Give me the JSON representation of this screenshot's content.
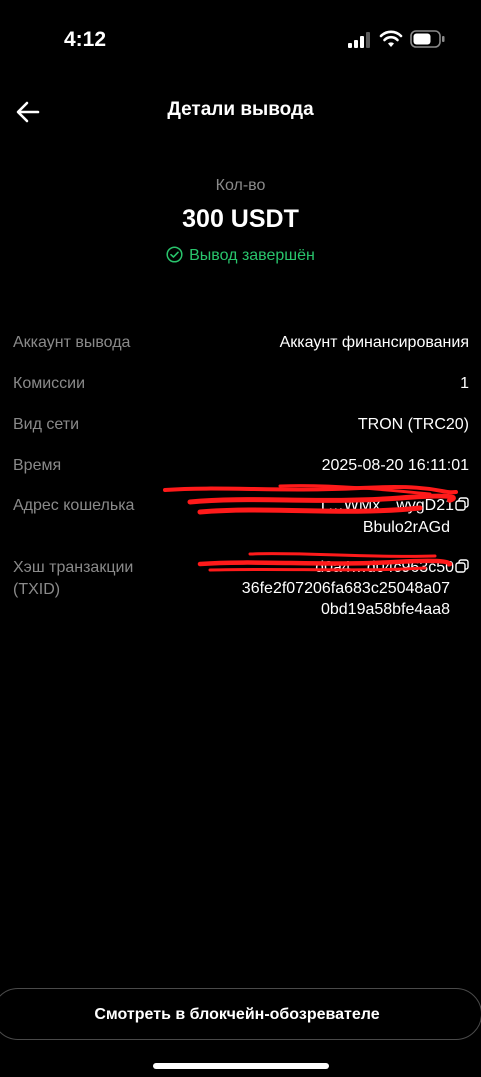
{
  "status_bar": {
    "time": "4:12",
    "signal_icon": "cellular-signal-icon",
    "wifi_icon": "wifi-icon",
    "battery_icon": "battery-icon"
  },
  "header": {
    "back_icon": "arrow-left-icon",
    "title": "Детали вывода"
  },
  "summary": {
    "amount_label": "Кол-во",
    "amount": "300 USDT",
    "status_text": "Вывод завершён",
    "status_icon": "check-circle-icon",
    "status_color": "#29c46c"
  },
  "details": {
    "account": {
      "label": "Аккаунт вывода",
      "value": "Аккаунт финансирования"
    },
    "fee": {
      "label": "Комиссии",
      "value": "1"
    },
    "network": {
      "label": "Вид сети",
      "value": "TRON (TRC20)"
    },
    "time": {
      "label": "Время",
      "value": "2025-08-20 16:11:01"
    },
    "address": {
      "label": "Адрес кошелька",
      "line1": "T…WMx…wygD21",
      "line2": "Bbulo2rAGd",
      "copy_icon": "copy-icon"
    },
    "txid": {
      "label_line1": "Хэш транзакции",
      "label_line2": "(TXID)",
      "line1": "d0a4…d04c963c50",
      "line2": "36fe2f07206fa683c25048a07",
      "line3": "0bd19a58bfe4aa8",
      "copy_icon": "copy-icon"
    }
  },
  "footer": {
    "explorer_button": "Смотреть в блокчейн-обозревателе"
  }
}
